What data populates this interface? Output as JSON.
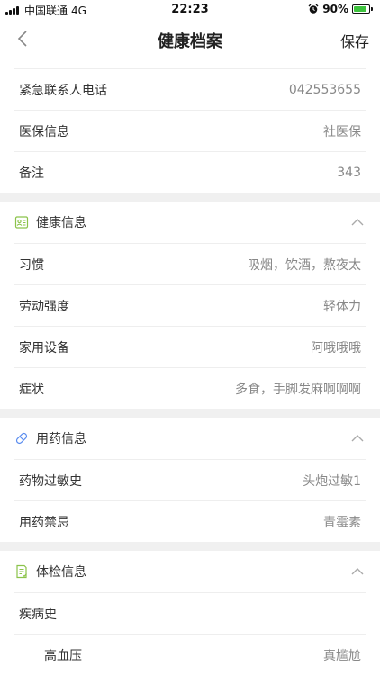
{
  "status_bar": {
    "carrier": "中国联通",
    "network": "4G",
    "time": "22:23",
    "battery": "90%",
    "battery_level": 0.9
  },
  "nav": {
    "title": "健康档案",
    "save_label": "保存"
  },
  "basic_rows": [
    {
      "label": "紧急联系人电话",
      "value": "042553655"
    },
    {
      "label": "医保信息",
      "value": "社医保"
    },
    {
      "label": "备注",
      "value": "343"
    }
  ],
  "health_section": {
    "title": "健康信息",
    "rows": [
      {
        "label": "习惯",
        "value": "吸烟，饮酒，熬夜太"
      },
      {
        "label": "劳动强度",
        "value": "轻体力"
      },
      {
        "label": "家用设备",
        "value": "阿哦哦哦"
      },
      {
        "label": "症状",
        "value": "多食，手脚发麻啊啊啊"
      }
    ]
  },
  "medication_section": {
    "title": "用药信息",
    "rows": [
      {
        "label": "药物过敏史",
        "value": "头炮过敏1"
      },
      {
        "label": "用药禁忌",
        "value": "青霉素"
      }
    ]
  },
  "exam_section": {
    "title": "体检信息",
    "disease_label": "疾病史",
    "disease_rows": [
      {
        "label": "高血压",
        "value": "真尴尬"
      }
    ]
  },
  "colors": {
    "accent_green": "#8bc34a",
    "accent_blue": "#5b8def",
    "battery_green": "#3ec33e"
  }
}
